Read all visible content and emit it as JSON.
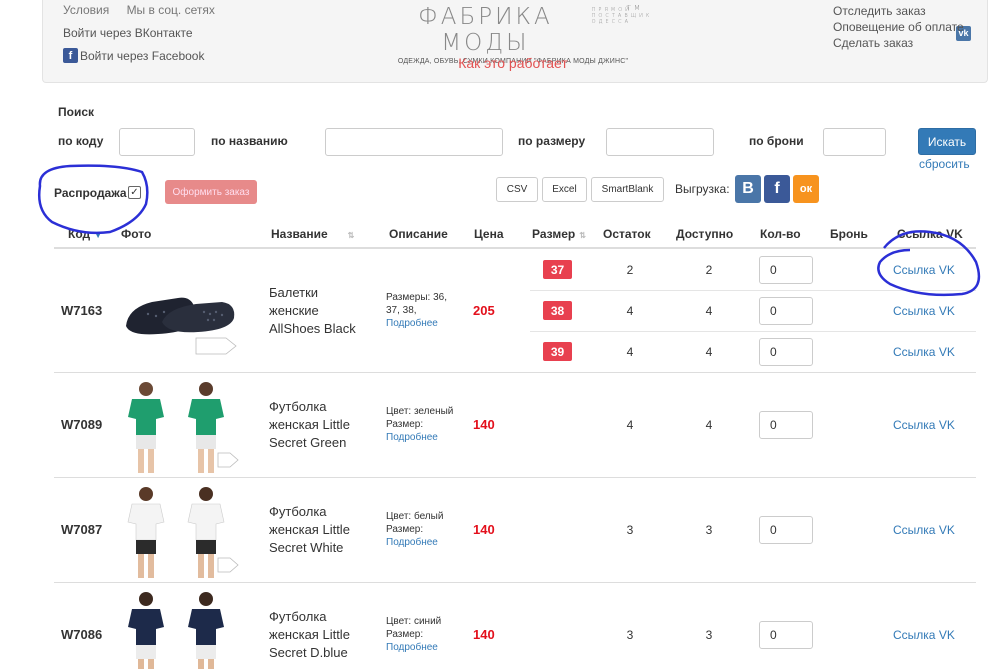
{
  "header": {
    "links_top": [
      "Условия",
      "Мы в соц. сетях"
    ],
    "login_vk": "Войти через ВКонтакте",
    "login_fb": "Войти через Facebook",
    "logo_title": "ФАБРИКА МОДЫ",
    "logo_subtitle": "ПРЯМОЙ ПОСТАВЩИК ОДЕССА",
    "logo_tm": "TM",
    "logo_tagline": "ОДЕЖДА, ОБУВЬ, СУМКИ КОМПАНИИ \"ФАБРИКА МОДЫ ДЖИНС\"",
    "how_it_works": "Как это работает",
    "links_right": [
      "Отследить заказ",
      "Оповещение об оплате",
      "Сделать заказ"
    ]
  },
  "search": {
    "title": "Поиск",
    "by_code": "по коду",
    "by_name": "по названию",
    "by_size": "по размеру",
    "by_booking": "по брони",
    "search_button": "Искать",
    "reset_link": "сбросить"
  },
  "toolbar": {
    "sale_label": "Распродажа",
    "sale_checked": true,
    "checkmark": "✓",
    "order_button": "Оформить заказ",
    "export_buttons": [
      "CSV",
      "Excel",
      "SmartBlank"
    ],
    "export_label": "Выгрузка:",
    "social": [
      {
        "name": "vk",
        "glyph": "В",
        "color": "#4a76a8"
      },
      {
        "name": "facebook",
        "glyph": "f",
        "color": "#3b5998"
      },
      {
        "name": "odnoklassniki",
        "glyph": "ок",
        "color": "#f7931e"
      }
    ]
  },
  "table": {
    "headers": [
      "Код",
      "Фото",
      "Название",
      "Описание",
      "Цена",
      "Размер",
      "Остаток",
      "Доступно",
      "Кол-во",
      "Бронь",
      "Ссылка VK"
    ],
    "sort_active_icon": "▼",
    "sort_icon": "⇅",
    "rows": [
      {
        "code": "W7163",
        "name": "Балетки женские AllShoes Black",
        "desc_line1": "Размеры: 36,",
        "desc_line2": "37, 38,",
        "desc_more": "Подробнее",
        "price": "205",
        "variants": [
          {
            "size": "37",
            "stock": "2",
            "available": "2",
            "qty": "0",
            "vk": "Ссылка VK"
          },
          {
            "size": "38",
            "stock": "4",
            "available": "4",
            "qty": "0",
            "vk": "Ссылка VK"
          },
          {
            "size": "39",
            "stock": "4",
            "available": "4",
            "qty": "0",
            "vk": "Ссылка VK"
          }
        ]
      },
      {
        "code": "W7089",
        "name": "Футболка женская Little Secret Green",
        "desc_line1": "Цвет: зеленый",
        "desc_line2": "Размер:",
        "desc_more": "Подробнее",
        "price": "140",
        "stock": "4",
        "available": "4",
        "qty": "0",
        "vk": "Ссылка VK"
      },
      {
        "code": "W7087",
        "name": "Футболка женская Little Secret White",
        "desc_line1": "Цвет: белый",
        "desc_line2": "Размер:",
        "desc_more": "Подробнее",
        "price": "140",
        "stock": "3",
        "available": "3",
        "qty": "0",
        "vk": "Ссылка VK"
      },
      {
        "code": "W7086",
        "name": "Футболка женская Little Secret D.blue",
        "desc_line1": "Цвет: синий",
        "desc_line2": "Размер:",
        "desc_more": "Подробнее",
        "price": "140",
        "stock": "3",
        "available": "3",
        "qty": "0",
        "vk": "Ссылка VK"
      }
    ]
  },
  "colors": {
    "accent": "#337ab7",
    "price": "#e3101c",
    "size_badge": "#e8404f",
    "annotation": "#2b2fd6"
  }
}
